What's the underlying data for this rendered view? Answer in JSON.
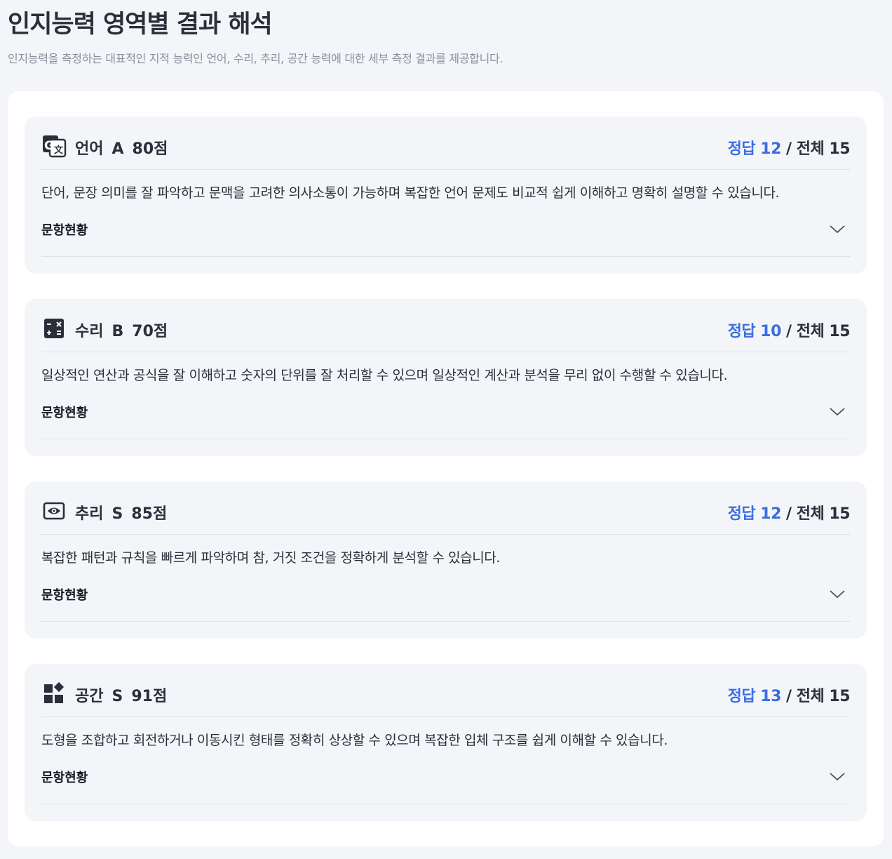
{
  "header": {
    "title": "인지능력 영역별 결과 해석",
    "subtitle": "인지능력을 측정하는 대표적인 지적 능력인 언어, 수리, 추리, 공간 능력에 대한 세부 측정 결과를 제공합니다."
  },
  "cards": [
    {
      "icon": "translate-icon",
      "area": "언어",
      "grade": "A",
      "score": "80점",
      "correct_label": "정답 12",
      "total_label": " / 전체 15",
      "description": "단어, 문장 의미를 잘 파악하고 문맥을 고려한 의사소통이 가능하며 복잡한 언어 문제도 비교적 쉽게 이해하고 명확히 설명할 수 있습니다.",
      "detail_label": "문항현황"
    },
    {
      "icon": "calculator-icon",
      "area": "수리",
      "grade": "B",
      "score": "70점",
      "correct_label": "정답 10",
      "total_label": " / 전체 15",
      "description": "일상적인 연산과 공식을 잘 이해하고 숫자의 단위를 잘 처리할 수 있으며 일상적인 계산과 분석을 무리 없이 수행할 수 있습니다.",
      "detail_label": "문항현황"
    },
    {
      "icon": "eye-icon",
      "area": "추리",
      "grade": "S",
      "score": "85점",
      "correct_label": "정답 12",
      "total_label": " / 전체 15",
      "description": "복잡한 패턴과 규칙을 빠르게 파악하며 참, 거짓 조건을 정확하게 분석할 수 있습니다.",
      "detail_label": "문항현황"
    },
    {
      "icon": "widgets-icon",
      "area": "공간",
      "grade": "S",
      "score": "91점",
      "correct_label": "정답 13",
      "total_label": " / 전체 15",
      "description": "도형을 조합하고 회전하거나 이동시킨 형태를 정확히 상상할 수 있으며 복잡한 입체 구조를 쉽게 이해할 수 있습니다.",
      "detail_label": "문항현황"
    }
  ],
  "colors": {
    "accent": "#3b6ee0",
    "text": "#2b2f3a",
    "background": "#f4f5f9"
  }
}
